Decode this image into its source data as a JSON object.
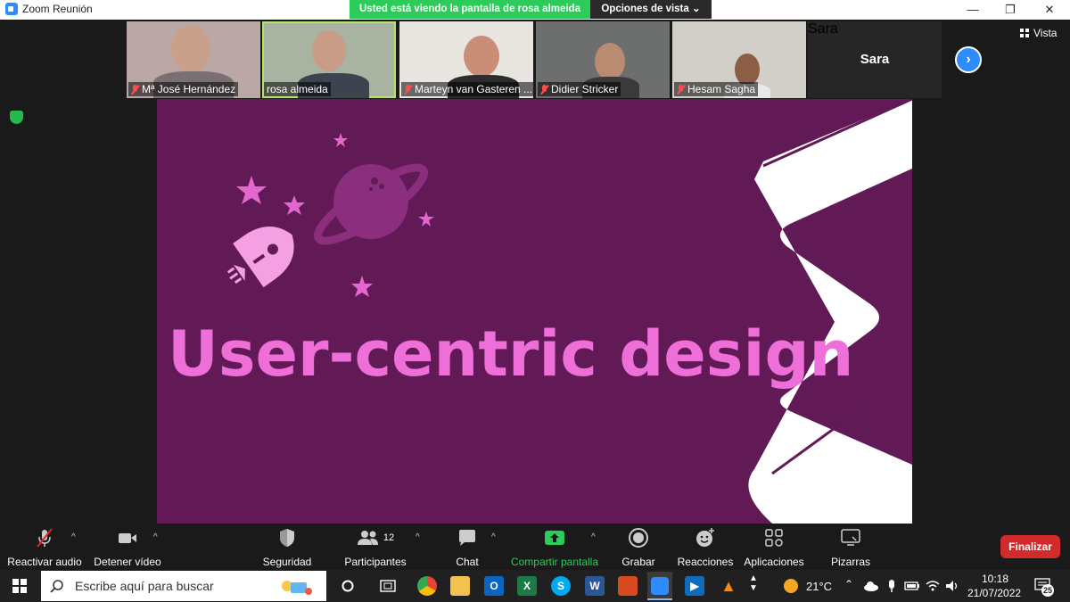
{
  "window": {
    "title": "Zoom Reunión",
    "share_banner": "Usted está viendo la pantalla de rosa almeida",
    "view_options": "Opciones de vista ⌄",
    "controls": {
      "minimize": "—",
      "restore": "❐",
      "close": "✕"
    }
  },
  "participants_strip": {
    "tiles": [
      {
        "name": "Mª José Hernández",
        "muted": true
      },
      {
        "name": "rosa almeida",
        "muted": false,
        "active_speaker": true
      },
      {
        "name": "Marteyn van Gasteren ...",
        "muted": true
      },
      {
        "name": "Didier Stricker",
        "muted": true
      },
      {
        "name": "Hesam Sagha",
        "muted": true
      }
    ],
    "sara_tile": {
      "big_label": "Sara",
      "name": "Sara"
    },
    "next_page_icon": "chevron-right-icon",
    "view_label": "Vista"
  },
  "slide": {
    "title": "User-centric design",
    "colors": {
      "background": "#611a56",
      "title": "#ee6fd8",
      "rocket": "#f5a0e3",
      "planet": "#8a2e7d"
    }
  },
  "toolbar": {
    "audio": "Reactivar audio",
    "video": "Detener vídeo",
    "security": "Seguridad",
    "participants": "Participantes",
    "participants_count": "12",
    "chat": "Chat",
    "share": "Compartir pantalla",
    "record": "Grabar",
    "reactions": "Reacciones",
    "apps": "Aplicaciones",
    "whiteboards": "Pizarras",
    "end": "Finalizar"
  },
  "taskbar": {
    "search_placeholder": "Escribe aquí para buscar",
    "weather": "21°C",
    "time": "10:18",
    "date": "21/07/2022",
    "notifications": "25"
  }
}
